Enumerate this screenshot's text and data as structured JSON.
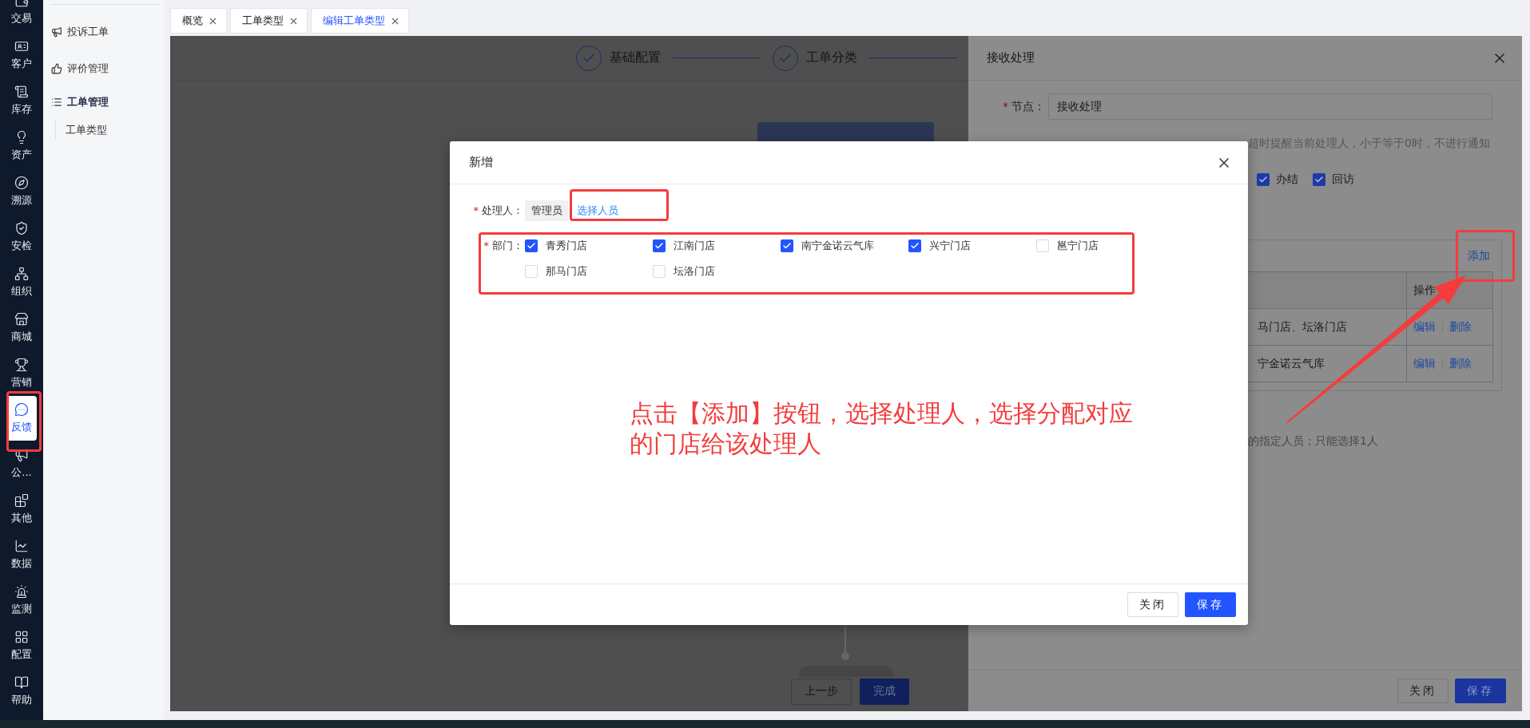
{
  "nav": [
    {
      "label": "交易",
      "selected": false
    },
    {
      "label": "客户",
      "selected": false
    },
    {
      "label": "库存",
      "selected": false
    },
    {
      "label": "资产",
      "selected": false
    },
    {
      "label": "溯源",
      "selected": false
    },
    {
      "label": "安检",
      "selected": false
    },
    {
      "label": "组织",
      "selected": false
    },
    {
      "label": "商城",
      "selected": false
    },
    {
      "label": "营销",
      "selected": false
    },
    {
      "label": "反馈",
      "selected": true
    },
    {
      "label": "公...",
      "selected": false
    },
    {
      "label": "其他",
      "selected": false
    },
    {
      "label": "数据",
      "selected": false
    },
    {
      "label": "监测",
      "selected": false
    },
    {
      "label": "配置",
      "selected": false
    },
    {
      "label": "帮助",
      "selected": false
    }
  ],
  "sidebar": {
    "items": [
      {
        "label": "投诉工单",
        "kind": "link"
      },
      {
        "label": "评价管理",
        "kind": "link"
      },
      {
        "label": "工单管理",
        "kind": "group",
        "children": [
          {
            "label": "工单类型"
          }
        ]
      }
    ]
  },
  "tabs": [
    {
      "label": "概览",
      "selected": false
    },
    {
      "label": "工单类型",
      "selected": false
    },
    {
      "label": "编辑工单类型",
      "selected": true
    }
  ],
  "stepper": [
    {
      "label": "基础配置",
      "done": true
    },
    {
      "label": "工单分类",
      "done": true
    }
  ],
  "canvas_buttons": [
    {
      "label": "上一步",
      "kind": "default"
    },
    {
      "label": "完成",
      "kind": "primary"
    }
  ],
  "drawer": {
    "title": "接收处理",
    "node": {
      "required_mark": "*",
      "label": "节点：",
      "value": "接收处理"
    },
    "time_hint": "超时提醒当前处理人，小于等于0时，不进行通知",
    "options": [
      {
        "label": "办结",
        "checked": true
      },
      {
        "label": "回访",
        "checked": true
      }
    ],
    "add_link": "添加",
    "table": {
      "columns": [
        "操作"
      ],
      "rows": [
        {
          "stores": "马门店、坛洛门店",
          "actions": [
            "编辑",
            "删除"
          ]
        },
        {
          "stores": "宁金诺云气库",
          "actions": [
            "编辑",
            "删除"
          ]
        }
      ]
    },
    "note": "的指定人员；只能选择1人",
    "buttons": [
      {
        "label": "关闭",
        "kind": "default"
      },
      {
        "label": "保存",
        "kind": "primary"
      }
    ]
  },
  "modal": {
    "title": "新增",
    "handler": {
      "required_mark": "*",
      "label": "处理人：",
      "tag": "管理员",
      "link": "选择人员"
    },
    "department": {
      "required_mark": "*",
      "label": "部门：",
      "options": [
        {
          "label": "青秀门店",
          "checked": true
        },
        {
          "label": "江南门店",
          "checked": true
        },
        {
          "label": "南宁金诺云气库",
          "checked": true
        },
        {
          "label": "兴宁门店",
          "checked": true
        },
        {
          "label": "邕宁门店",
          "checked": false
        },
        {
          "label": "那马门店",
          "checked": false
        },
        {
          "label": "坛洛门店",
          "checked": false
        }
      ]
    },
    "buttons": [
      {
        "label": "关闭",
        "kind": "default"
      },
      {
        "label": "保存",
        "kind": "primary"
      }
    ]
  },
  "annotation": {
    "note": "点击【添加】按钮，选择处理人，选择分配对应的门店给该处理人"
  }
}
